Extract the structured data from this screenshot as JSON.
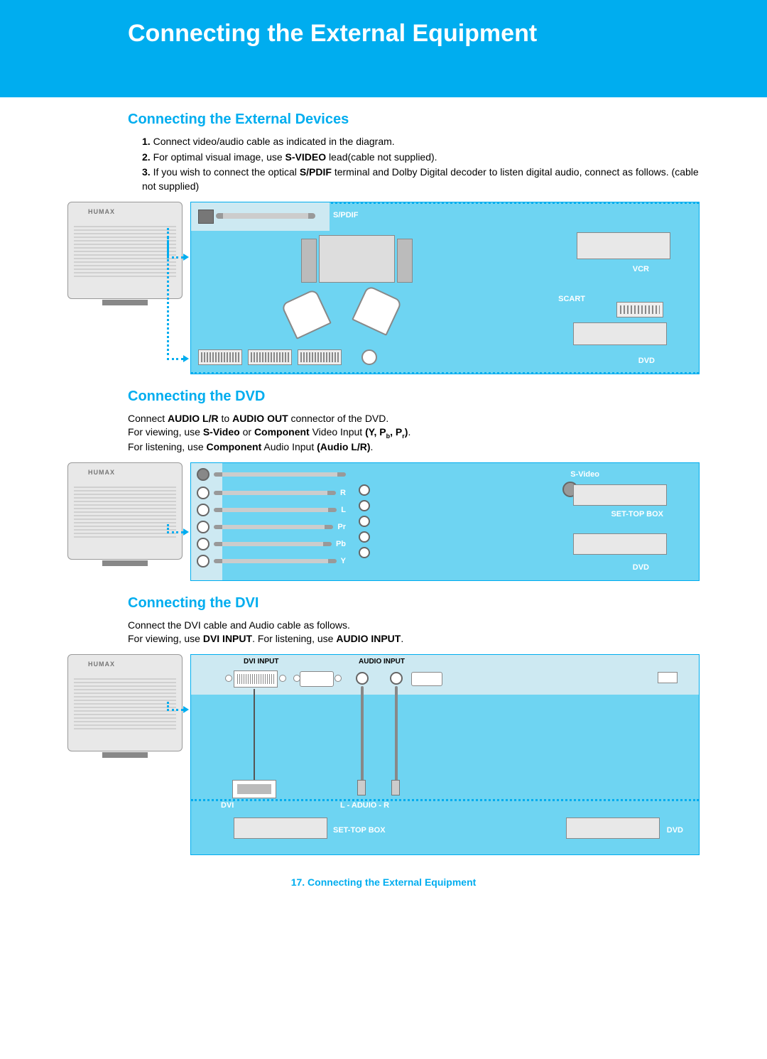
{
  "page_title": "Connecting the External Equipment",
  "sections": {
    "ext_devices": {
      "heading": "Connecting the External Devices",
      "steps": [
        "Connect video/audio cable as indicated in the diagram.",
        "For optimal visual image, use S-VIDEO lead(cable not supplied).",
        "If you wish to connect the optical S/PDIF terminal and Dolby Digital decoder to listen digital audio, connect as follows. (cable not supplied)"
      ],
      "diagram": {
        "spdif": "S/PDIF",
        "vcr": "VCR",
        "scart": "SCART",
        "dvd": "DVD",
        "tv_brand": "HUMAX"
      }
    },
    "dvd": {
      "heading": "Connecting the DVD",
      "body": {
        "line1_pre": "Connect ",
        "line1_b1": "AUDIO L/R",
        "line1_mid": " to ",
        "line1_b2": "AUDIO OUT",
        "line1_post": " connector of the DVD.",
        "line2_pre": "For viewing, use ",
        "line2_b1": "S-Video",
        "line2_mid": " or ",
        "line2_b2": "Component",
        "line2_post": " Video Input ",
        "line2_b3": "(Y, Pb, Pr)",
        "line2_end": ".",
        "line3_pre": "For listening, use ",
        "line3_b1": "Component",
        "line3_mid": " Audio Input ",
        "line3_b2": "(Audio L/R)",
        "line3_end": "."
      },
      "diagram": {
        "svideo": "S-Video",
        "settop": "SET-TOP BOX",
        "dvd": "DVD",
        "rows": [
          "R",
          "L",
          "Pr",
          "Pb",
          "Y"
        ],
        "tv_brand": "HUMAX"
      }
    },
    "dvi": {
      "heading": "Connecting the DVI",
      "body": {
        "line1": "Connect the DVI cable and Audio cable as follows.",
        "line2_pre": "For viewing, use ",
        "line2_b1": "DVI INPUT",
        "line2_mid": ". For listening, use ",
        "line2_b2": "AUDIO INPUT",
        "line2_end": "."
      },
      "diagram": {
        "dvi_input": "DVI INPUT",
        "audio_input": "AUDIO INPUT",
        "dvi": "DVI",
        "lr": "L - ADUIO - R",
        "settop": "SET-TOP BOX",
        "dvd": "DVD",
        "tv_brand": "HUMAX"
      }
    }
  },
  "footer": {
    "page_num": "17.",
    "text": "Connecting the External Equipment"
  }
}
